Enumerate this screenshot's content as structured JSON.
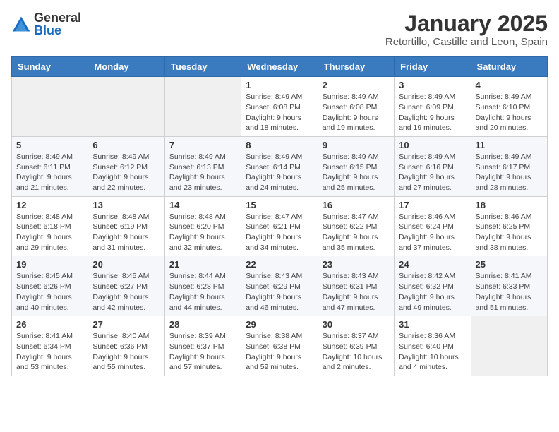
{
  "header": {
    "logo_general": "General",
    "logo_blue": "Blue",
    "title": "January 2025",
    "subtitle": "Retortillo, Castille and Leon, Spain"
  },
  "days_of_week": [
    "Sunday",
    "Monday",
    "Tuesday",
    "Wednesday",
    "Thursday",
    "Friday",
    "Saturday"
  ],
  "weeks": [
    {
      "days": [
        {
          "number": "",
          "info": ""
        },
        {
          "number": "",
          "info": ""
        },
        {
          "number": "",
          "info": ""
        },
        {
          "number": "1",
          "info": "Sunrise: 8:49 AM\nSunset: 6:08 PM\nDaylight: 9 hours and 18 minutes."
        },
        {
          "number": "2",
          "info": "Sunrise: 8:49 AM\nSunset: 6:08 PM\nDaylight: 9 hours and 19 minutes."
        },
        {
          "number": "3",
          "info": "Sunrise: 8:49 AM\nSunset: 6:09 PM\nDaylight: 9 hours and 19 minutes."
        },
        {
          "number": "4",
          "info": "Sunrise: 8:49 AM\nSunset: 6:10 PM\nDaylight: 9 hours and 20 minutes."
        }
      ]
    },
    {
      "days": [
        {
          "number": "5",
          "info": "Sunrise: 8:49 AM\nSunset: 6:11 PM\nDaylight: 9 hours and 21 minutes."
        },
        {
          "number": "6",
          "info": "Sunrise: 8:49 AM\nSunset: 6:12 PM\nDaylight: 9 hours and 22 minutes."
        },
        {
          "number": "7",
          "info": "Sunrise: 8:49 AM\nSunset: 6:13 PM\nDaylight: 9 hours and 23 minutes."
        },
        {
          "number": "8",
          "info": "Sunrise: 8:49 AM\nSunset: 6:14 PM\nDaylight: 9 hours and 24 minutes."
        },
        {
          "number": "9",
          "info": "Sunrise: 8:49 AM\nSunset: 6:15 PM\nDaylight: 9 hours and 25 minutes."
        },
        {
          "number": "10",
          "info": "Sunrise: 8:49 AM\nSunset: 6:16 PM\nDaylight: 9 hours and 27 minutes."
        },
        {
          "number": "11",
          "info": "Sunrise: 8:49 AM\nSunset: 6:17 PM\nDaylight: 9 hours and 28 minutes."
        }
      ]
    },
    {
      "days": [
        {
          "number": "12",
          "info": "Sunrise: 8:48 AM\nSunset: 6:18 PM\nDaylight: 9 hours and 29 minutes."
        },
        {
          "number": "13",
          "info": "Sunrise: 8:48 AM\nSunset: 6:19 PM\nDaylight: 9 hours and 31 minutes."
        },
        {
          "number": "14",
          "info": "Sunrise: 8:48 AM\nSunset: 6:20 PM\nDaylight: 9 hours and 32 minutes."
        },
        {
          "number": "15",
          "info": "Sunrise: 8:47 AM\nSunset: 6:21 PM\nDaylight: 9 hours and 34 minutes."
        },
        {
          "number": "16",
          "info": "Sunrise: 8:47 AM\nSunset: 6:22 PM\nDaylight: 9 hours and 35 minutes."
        },
        {
          "number": "17",
          "info": "Sunrise: 8:46 AM\nSunset: 6:24 PM\nDaylight: 9 hours and 37 minutes."
        },
        {
          "number": "18",
          "info": "Sunrise: 8:46 AM\nSunset: 6:25 PM\nDaylight: 9 hours and 38 minutes."
        }
      ]
    },
    {
      "days": [
        {
          "number": "19",
          "info": "Sunrise: 8:45 AM\nSunset: 6:26 PM\nDaylight: 9 hours and 40 minutes."
        },
        {
          "number": "20",
          "info": "Sunrise: 8:45 AM\nSunset: 6:27 PM\nDaylight: 9 hours and 42 minutes."
        },
        {
          "number": "21",
          "info": "Sunrise: 8:44 AM\nSunset: 6:28 PM\nDaylight: 9 hours and 44 minutes."
        },
        {
          "number": "22",
          "info": "Sunrise: 8:43 AM\nSunset: 6:29 PM\nDaylight: 9 hours and 46 minutes."
        },
        {
          "number": "23",
          "info": "Sunrise: 8:43 AM\nSunset: 6:31 PM\nDaylight: 9 hours and 47 minutes."
        },
        {
          "number": "24",
          "info": "Sunrise: 8:42 AM\nSunset: 6:32 PM\nDaylight: 9 hours and 49 minutes."
        },
        {
          "number": "25",
          "info": "Sunrise: 8:41 AM\nSunset: 6:33 PM\nDaylight: 9 hours and 51 minutes."
        }
      ]
    },
    {
      "days": [
        {
          "number": "26",
          "info": "Sunrise: 8:41 AM\nSunset: 6:34 PM\nDaylight: 9 hours and 53 minutes."
        },
        {
          "number": "27",
          "info": "Sunrise: 8:40 AM\nSunset: 6:36 PM\nDaylight: 9 hours and 55 minutes."
        },
        {
          "number": "28",
          "info": "Sunrise: 8:39 AM\nSunset: 6:37 PM\nDaylight: 9 hours and 57 minutes."
        },
        {
          "number": "29",
          "info": "Sunrise: 8:38 AM\nSunset: 6:38 PM\nDaylight: 9 hours and 59 minutes."
        },
        {
          "number": "30",
          "info": "Sunrise: 8:37 AM\nSunset: 6:39 PM\nDaylight: 10 hours and 2 minutes."
        },
        {
          "number": "31",
          "info": "Sunrise: 8:36 AM\nSunset: 6:40 PM\nDaylight: 10 hours and 4 minutes."
        },
        {
          "number": "",
          "info": ""
        }
      ]
    }
  ]
}
